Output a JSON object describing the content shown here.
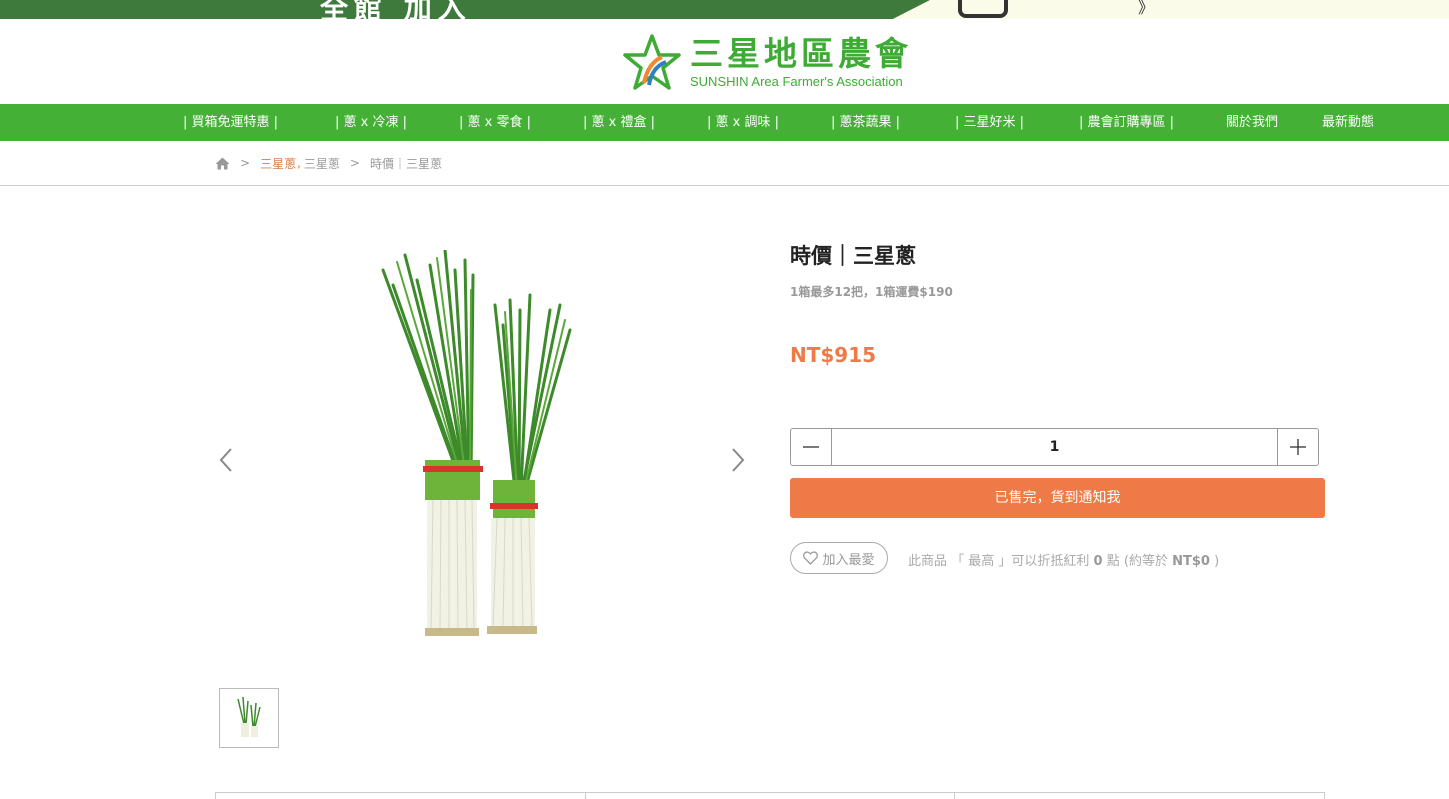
{
  "promo": {
    "text": "全館 加入 ",
    "tail": "》"
  },
  "logo": {
    "cn": "三星地區農會",
    "en": "SUNSHIN Area Farmer's Association"
  },
  "nav": {
    "items": [
      "| 買箱免運特惠 |",
      "| 蔥 x 冷凍 |",
      "| 蔥 x 零食 |",
      "| 蔥 x 禮盒 |",
      "| 蔥 x 調味 |",
      "| 蔥茶蔬果 |",
      "| 三星好米 |",
      "| 農會訂購專區 |",
      "關於我們",
      "最新動態"
    ]
  },
  "breadcrumb": {
    "sep1": ">",
    "cat_active": "三星蔥",
    "comma": ",",
    "cat2": "三星蔥",
    "sep2": ">",
    "current": "時價｜三星蔥"
  },
  "product": {
    "title": "時價｜三星蔥",
    "subtitle": "1箱最多12把，1箱運費$190",
    "price": "NT$915",
    "quantity": "1",
    "sold_out_label": "已售完，貨到通知我",
    "favorite_label": "加入最愛",
    "points": {
      "prefix": "此商品 「 最高 」可以折抵紅利",
      "amount": "0",
      "unit": "點 (約等於",
      "value": "NT$0",
      "suffix": ")"
    }
  },
  "colors": {
    "brand_green": "#44b035",
    "accent_orange": "#f07a47"
  },
  "icons": {
    "home": "home-icon",
    "prev": "chevron-left-icon",
    "next": "chevron-right-icon",
    "minus": "minus-icon",
    "plus": "plus-icon",
    "heart": "heart-icon"
  }
}
